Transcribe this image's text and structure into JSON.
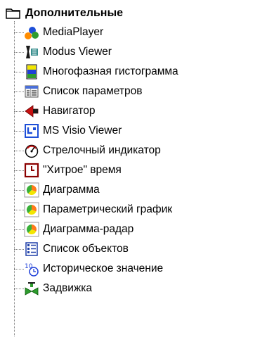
{
  "tree": {
    "root": {
      "label": "Дополнительные",
      "icon": "folder-icon"
    },
    "items": [
      {
        "label": "MediaPlayer",
        "icon": "media-player-icon"
      },
      {
        "label": "Modus Viewer",
        "icon": "modus-viewer-icon"
      },
      {
        "label": "Многофазная гистограмма",
        "icon": "multiphase-histogram-icon"
      },
      {
        "label": "Список параметров",
        "icon": "parameter-list-icon"
      },
      {
        "label": "Навигатор",
        "icon": "navigator-icon"
      },
      {
        "label": "MS Visio Viewer",
        "icon": "visio-viewer-icon"
      },
      {
        "label": "Стрелочный индикатор",
        "icon": "dial-indicator-icon"
      },
      {
        "label": "\"Хитрое\" время",
        "icon": "tricky-time-icon"
      },
      {
        "label": "Диаграмма",
        "icon": "pie-chart-icon"
      },
      {
        "label": "Параметрический график",
        "icon": "pie-chart-icon"
      },
      {
        "label": "Диаграмма-радар",
        "icon": "pie-chart-icon"
      },
      {
        "label": "Список объектов",
        "icon": "object-list-icon"
      },
      {
        "label": "Историческое значение",
        "icon": "historic-value-icon"
      },
      {
        "label": "Задвижка",
        "icon": "valve-icon"
      }
    ]
  }
}
